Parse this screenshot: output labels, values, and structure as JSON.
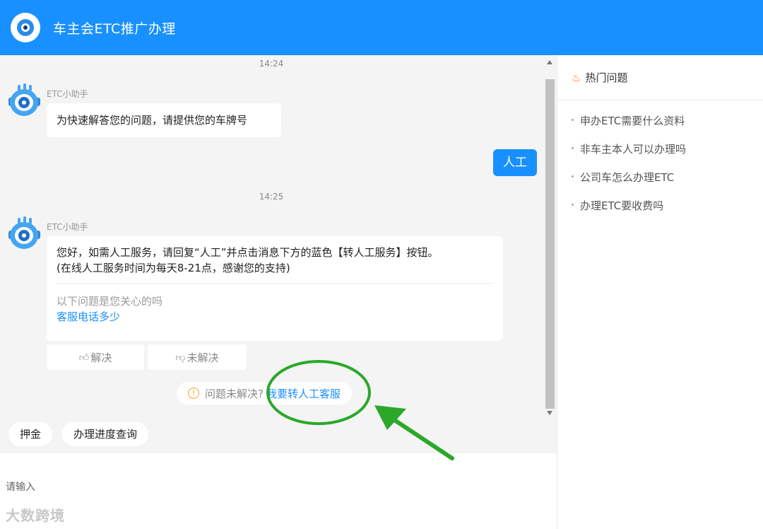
{
  "header": {
    "title": "车主会ETC推广办理"
  },
  "chat": {
    "time1": "14:24",
    "bot_name_1": "ETC小助手",
    "msg1": "为快速解答您的问题，请提供您的车牌号",
    "user_msg": "人工",
    "time2": "14:25",
    "bot_name_2": "ETC小助手",
    "msg2_line1": "您好，如需人工服务，请回复“人工”并点击消息下方的蓝色【转人工服务】按钮。",
    "msg2_line2": "(在线人工服务时间为每天8-21点，感谢您的支持)",
    "msg2_hint": "以下问题是您关心的吗",
    "msg2_link": "客服电话多少",
    "feedback_resolved": "解决",
    "feedback_unresolved": "未解决",
    "notice_text": "问题未解决?",
    "notice_link": "我要转人工客服",
    "quick_replies": [
      "押金",
      "办理进度查询"
    ]
  },
  "input": {
    "placeholder": "请输入"
  },
  "watermark": "大数跨境",
  "sidebar": {
    "title": "热门问题",
    "items": [
      "申办ETC需要什么资料",
      "非车主本人可以办理吗",
      "公司车怎么办理ETC",
      "办理ETC要收费吗"
    ]
  },
  "colors": {
    "primary": "#1890ff",
    "annotation": "#2aa82a"
  },
  "icons": [
    "logo-icon",
    "bot-avatar-icon",
    "thumbs-up-icon",
    "thumbs-down-icon",
    "warning-icon",
    "fire-icon"
  ]
}
